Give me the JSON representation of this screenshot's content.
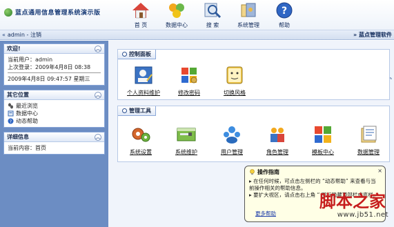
{
  "app": {
    "title": "蓝点通用信息管理系统演示版",
    "brand": "蓝点管理软件"
  },
  "topnav": [
    {
      "label": "首 页",
      "icon": "home-icon"
    },
    {
      "label": "数据中心",
      "icon": "data-center-icon"
    },
    {
      "label": "搜 索",
      "icon": "search-icon"
    },
    {
      "label": "系统管理",
      "icon": "system-admin-icon"
    },
    {
      "label": "帮助",
      "icon": "help-icon"
    }
  ],
  "strip": {
    "user_text": "admin - 注销"
  },
  "welcome": {
    "title": "欢迎!",
    "user_line": "当前用户：admin",
    "last_login": "上次登录：2009年4月8日  08:38",
    "now": "2009年4月8日  09:47:57   星期三"
  },
  "other": {
    "title": "其它位置",
    "links": [
      {
        "label": "最近浏览",
        "icon": "footprints-icon"
      },
      {
        "label": "数据中心",
        "icon": "data-icon"
      },
      {
        "label": "动态帮助",
        "icon": "help-icon"
      }
    ]
  },
  "detail": {
    "title": "详细信息",
    "content": "当前内容：首页"
  },
  "control_panel": {
    "title": "控制面板",
    "items": [
      {
        "label": "个人资料维护",
        "icon": "profile-icon"
      },
      {
        "label": "修改密码",
        "icon": "password-icon"
      },
      {
        "label": "切换风格",
        "icon": "style-icon"
      }
    ]
  },
  "admin_tools": {
    "title": "管理工具",
    "items": [
      {
        "label": "系统设置",
        "icon": "settings-icon"
      },
      {
        "label": "系统维护",
        "icon": "maintenance-icon"
      },
      {
        "label": "用户管理",
        "icon": "users-icon"
      },
      {
        "label": "角色管理",
        "icon": "roles-icon"
      },
      {
        "label": "模板中心",
        "icon": "template-icon"
      },
      {
        "label": "数据管理",
        "icon": "data-manage-icon"
      }
    ]
  },
  "tip": {
    "title": "操作指南",
    "line1": "▸ 在任何时候，可点击左侧栏的 “动态帮助” 来查看与当前操作相关的帮助信息。",
    "line2": "▸ 要扩大视区，请点击右上角 “ 图标隐藏顶部栏或底栏。",
    "more": "更多帮助",
    "close": "×"
  },
  "watermark": {
    "text": "脚本之家",
    "url": "www.jb51.net"
  }
}
